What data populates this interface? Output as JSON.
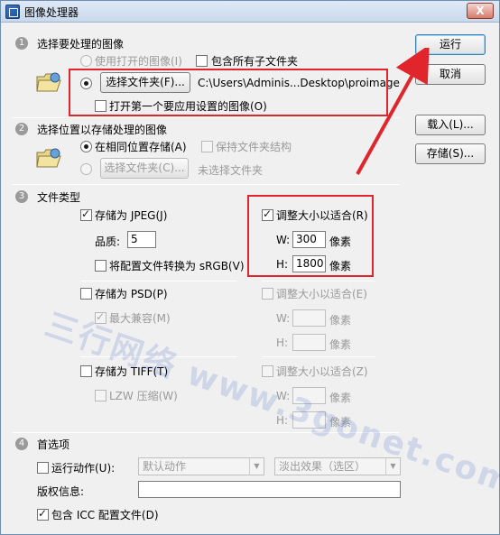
{
  "window": {
    "title": "图像处理器",
    "close": "X"
  },
  "side_buttons": {
    "run": "运行",
    "cancel": "取消",
    "load": "载入(L)...",
    "save": "存储(S)..."
  },
  "section1": {
    "number": "1",
    "title": "选择要处理的图像",
    "use_open_images": "使用打开的图像(I)",
    "include_subfolders": "包含所有子文件夹",
    "choose_folder_button": "选择文件夹(F)...",
    "folder_path": "C:\\Users\\Adminis...Desktop\\proimage",
    "open_first_image": "打开第一个要应用设置的图像(O)"
  },
  "section2": {
    "number": "2",
    "title": "选择位置以存储处理的图像",
    "save_same_location": "在相同位置存储(A)",
    "keep_folder_structure": "保持文件夹结构",
    "choose_folder_button": "选择文件夹(C)...",
    "no_folder_selected": "未选择文件夹"
  },
  "section3": {
    "number": "3",
    "title": "文件类型",
    "jpeg": {
      "save_as": "存储为 JPEG(J)",
      "quality_label": "品质:",
      "quality_value": "5",
      "convert_srgb": "将配置文件转换为 sRGB(V)",
      "resize": "调整大小以适合(R)",
      "w_label": "W:",
      "w_value": "300",
      "w_unit": "像素",
      "h_label": "H:",
      "h_value": "1800",
      "h_unit": "像素"
    },
    "psd": {
      "save_as": "存储为 PSD(P)",
      "max_compat": "最大兼容(M)",
      "resize": "调整大小以适合(E)",
      "w_label": "W:",
      "w_unit": "像素",
      "h_label": "H:",
      "h_unit": "像素"
    },
    "tiff": {
      "save_as": "存储为 TIFF(T)",
      "lzw": "LZW 压缩(W)",
      "resize": "调整大小以适合(Z)",
      "w_label": "W:",
      "w_unit": "像素",
      "h_label": "H:",
      "h_unit": "像素"
    }
  },
  "section4": {
    "number": "4",
    "title": "首选项",
    "run_action": "运行动作(U):",
    "action_set": "默认动作",
    "action": "淡出效果（选区）",
    "copyright_label": "版权信息:",
    "copyright_value": "",
    "include_icc": "包含 ICC 配置文件(D)"
  },
  "watermark": "三行网络 www.3gonet.com",
  "colors": {
    "highlight": "#e0262c",
    "title_bar": "#c9d9ec"
  }
}
